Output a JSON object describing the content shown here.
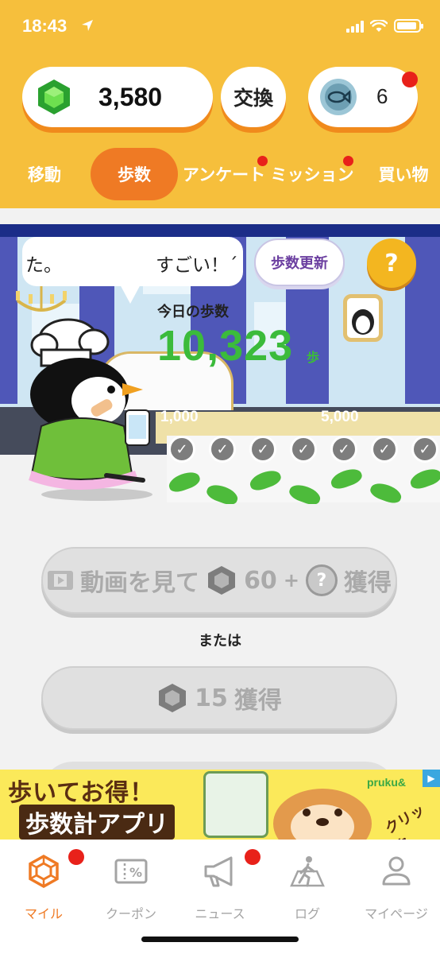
{
  "status_bar": {
    "time": "18:43"
  },
  "header": {
    "gem_balance": "3,580",
    "exchange_label": "交換",
    "ticket_count": "6"
  },
  "tabs": [
    {
      "label": "移動",
      "active": false
    },
    {
      "label": "歩数",
      "active": true
    },
    {
      "label": "アンケート",
      "active": false,
      "badge": true
    },
    {
      "label": "ミッション",
      "active": false,
      "badge": true
    },
    {
      "label": "買い物",
      "active": false
    }
  ],
  "scene": {
    "bubble_text_left": "た。",
    "bubble_text_right": "すごい！´",
    "update_button": "歩数更新",
    "help_button": "?",
    "steps_title": "今日の歩数",
    "steps_value": "10,323",
    "steps_unit": "歩",
    "milestones": [
      "1,000",
      "5,000"
    ],
    "checkpoints_done": 7
  },
  "actions": {
    "video_label": "動画を見て",
    "video_gems": "60",
    "video_plus": "+",
    "video_mystery": "?",
    "video_earn": "獲得",
    "or_text": "または",
    "earn_amount": "15",
    "earn_label": "獲得"
  },
  "banner": {
    "title": "歩いてお得！",
    "subtitle": "歩数計アプリ",
    "logo": "pruku&",
    "click_label": "クリック"
  },
  "bottom_nav": [
    {
      "label": "マイル",
      "icon": "hexagon-icon",
      "active": true,
      "badge": true
    },
    {
      "label": "クーポン",
      "icon": "coupon-icon",
      "active": false,
      "badge": false
    },
    {
      "label": "ニュース",
      "icon": "megaphone-icon",
      "active": false,
      "badge": true
    },
    {
      "label": "ログ",
      "icon": "walker-icon",
      "active": false,
      "badge": false
    },
    {
      "label": "マイページ",
      "icon": "person-icon",
      "active": false,
      "badge": false
    }
  ],
  "colors": {
    "header_bg": "#f6bf3c",
    "accent_orange": "#ef7a24",
    "steps_green": "#3bbb3b",
    "badge_red": "#e8211a"
  }
}
